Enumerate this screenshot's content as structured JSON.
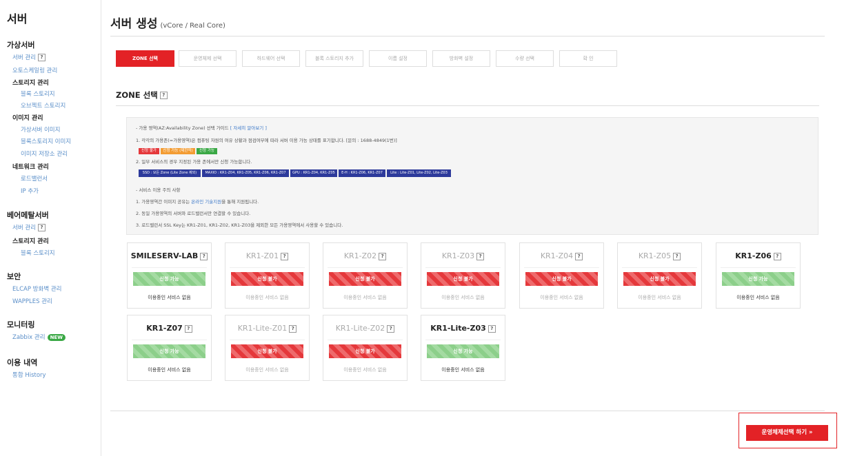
{
  "sidebar": {
    "title": "서버",
    "virtual": {
      "title": "가상서버",
      "server_mgmt": "서버 관리",
      "autoscaling": "오토스케일링 관리",
      "storage_mgmt": "스토리지 관리",
      "block_storage": "블록 스토리지",
      "object_storage": "오브젝트 스토리지",
      "image_mgmt": "이미지 관리",
      "vserver_image": "가상서버 이미지",
      "block_image": "블록스토리지 이미지",
      "image_store": "이미지 저장소 관리",
      "network_mgmt": "네트워크 관리",
      "load_balancer": "로드밸런서",
      "ip_add": "IP 추가"
    },
    "baremetal": {
      "title": "베어메탈서버",
      "server_mgmt": "서버 관리",
      "storage_mgmt": "스토리지 관리",
      "block_storage": "블록 스토리지"
    },
    "security": {
      "title": "보안",
      "elcap": "ELCAP 방화벽 관리",
      "wapples": "WAPPLES 관리"
    },
    "monitoring": {
      "title": "모니터링",
      "zabbix": "Zabbix 관리",
      "new_badge": "NEW"
    },
    "usage": {
      "title": "이용 내역",
      "history": "통합 History"
    },
    "help_glyph": "?"
  },
  "page": {
    "title": "서버 생성",
    "subtitle": "(vCore / Real Core)"
  },
  "steps": [
    "ZONE 선택",
    "운영체제 선택",
    "하드웨어 선택",
    "블록 스토리지 추가",
    "이름 설정",
    "방화벽 설정",
    "수량 선택",
    "확 인"
  ],
  "section_title": "ZONE 선택",
  "guide": {
    "heading": "- 가용 영역(AZ:Availability Zone) 선택 가이드",
    "heading_link": "[ 자세히 알아보기 ]",
    "line1": "1. 각각의 가용존(=가용영역)은 컴퓨팅 자원의 여유 상황과 점검여부에 따라 서버 이용 가능 상태를 표기합니다. [문의 : 1688-4849(1번)]",
    "legend": [
      "신청 불가",
      "신청 가능 (제한적)",
      "신청 가능"
    ],
    "line2": "2. 일부 서비스의 경우 지정된 가용 존에서만 신청 가능합니다.",
    "zone_tags": [
      "SSD : 모든 Zone (Lite Zone 제외)",
      "MAXIO : KR1-Z04, KR1-Z05, KR1-Z06, KR1-Z07",
      "GPU : KR1-Z04, KR1-Z05",
      "E-H : KR1-Z06, KR1-Z07",
      "Lite : Lite-Z01, Lite-Z02, Lite-Z03"
    ],
    "caution_heading": "- 서비스 이용 주의 사항",
    "caution1_a": "1. 가용영역간 이미지 공유는 ",
    "caution1_link": "온라인 기술지원",
    "caution1_b": "을 통해 지원됩니다.",
    "caution2": "2. 동일 가용영역의 서버와 로드밸런서만 연결할 수 있습니다.",
    "caution3": "3. 로드밸런서 SSL Key는 KR1-Z01, KR1-Z02, KR1-Z03을 제외한 모든 가용영역에서 사용할 수 있습니다."
  },
  "zones": [
    {
      "name": "SMILESERV-LAB",
      "button": "신청 가능",
      "status": "이용중인 서비스 없음"
    },
    {
      "name": "KR1-Z01",
      "button": "신청 불가",
      "status": "이용중인 서비스 없음"
    },
    {
      "name": "KR1-Z02",
      "button": "신청 불가",
      "status": "이용중인 서비스 없음"
    },
    {
      "name": "KR1-Z03",
      "button": "신청 불가",
      "status": "이용중인 서비스 없음"
    },
    {
      "name": "KR1-Z04",
      "button": "신청 불가",
      "status": "이용중인 서비스 없음"
    },
    {
      "name": "KR1-Z05",
      "button": "신청 불가",
      "status": "이용중인 서비스 없음"
    },
    {
      "name": "KR1-Z06",
      "button": "신청 가능",
      "status": "이용중인 서비스 없음"
    },
    {
      "name": "KR1-Z07",
      "button": "신청 가능",
      "status": "이용중인 서비스 없음"
    },
    {
      "name": "KR1-Lite-Z01",
      "button": "신청 불가",
      "status": "이용중인 서비스 없음"
    },
    {
      "name": "KR1-Lite-Z02",
      "button": "신청 불가",
      "status": "이용중인 서비스 없음"
    },
    {
      "name": "KR1-Lite-Z03",
      "button": "신청 가능",
      "status": "이용중인 서비스 없음"
    }
  ],
  "next_button": "운영체제선택 하기 »",
  "colors": {
    "brand": "#e32226",
    "available": "#8ccf8a",
    "unavailable": "#e5383b",
    "limited": "#f39c33",
    "link": "#5b8fc9",
    "zone_tag": "#2d3a9b"
  }
}
